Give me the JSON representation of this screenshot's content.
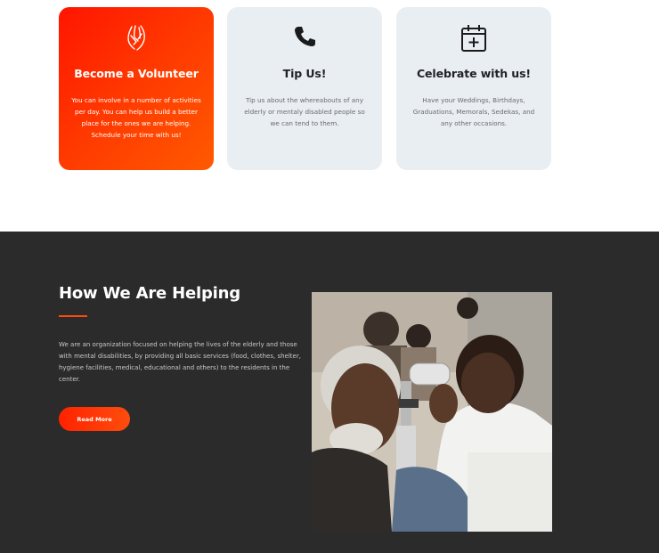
{
  "cards": [
    {
      "icon": "praying-hands-icon",
      "title": "Become a Volunteer",
      "text": "You can involve in a number of activities per day. You can help us build a better place for the ones we are helping. Schedule your time with us!"
    },
    {
      "icon": "phone-icon",
      "title": "Tip Us!",
      "text": "Tip us about the whereabouts of any elderly or mentaly disabled people so we can tend to them."
    },
    {
      "icon": "calendar-plus-icon",
      "title": "Celebrate with us!",
      "text": "Have your Weddings, Birthdays, Graduations, Memorals, Sedekas, and any other occasions."
    }
  ],
  "helping": {
    "title": "How We Are Helping",
    "description": "We are an organization focused on helping the lives of the elderly and those with mental disabilities, by providing all basic services (food, clothes, shelter, hygiene facilities, medical, educational and others) to the residents in the center.",
    "button_label": "Read More"
  },
  "colors": {
    "accent": "#ff3a00",
    "card_bg": "#e9eef3",
    "dark_bg": "#2b2b2b"
  }
}
